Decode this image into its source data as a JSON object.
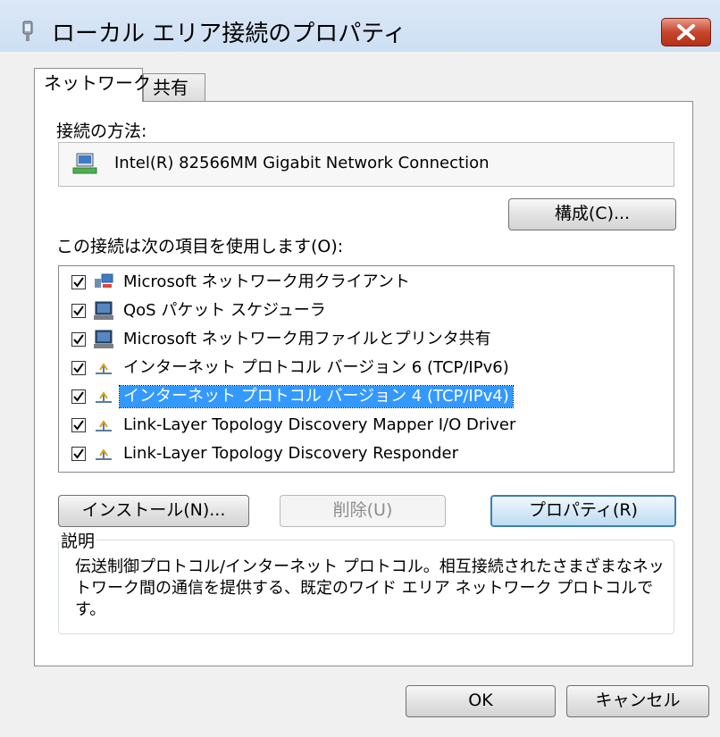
{
  "window": {
    "title": "ローカル エリア接続のプロパティ"
  },
  "tabs": [
    {
      "label": "ネットワーク"
    },
    {
      "label": "共有"
    }
  ],
  "connect_using": {
    "label": "接続の方法:",
    "adapter": "Intel(R) 82566MM Gigabit Network Connection",
    "configure_button": "構成(C)..."
  },
  "items_label": "この接続は次の項目を使用します(O):",
  "items": [
    {
      "label": "Microsoft ネットワーク用クライアント",
      "checked": true,
      "icon": "network-client-icon"
    },
    {
      "label": "QoS パケット スケジューラ",
      "checked": true,
      "icon": "service-icon"
    },
    {
      "label": "Microsoft ネットワーク用ファイルとプリンタ共有",
      "checked": true,
      "icon": "service-icon"
    },
    {
      "label": "インターネット プロトコル バージョン 6 (TCP/IPv6)",
      "checked": true,
      "icon": "protocol-icon"
    },
    {
      "label": "インターネット プロトコル バージョン 4 (TCP/IPv4)",
      "checked": true,
      "icon": "protocol-icon",
      "selected": true
    },
    {
      "label": "Link-Layer Topology Discovery Mapper I/O Driver",
      "checked": true,
      "icon": "protocol-icon"
    },
    {
      "label": "Link-Layer Topology Discovery Responder",
      "checked": true,
      "icon": "protocol-icon"
    }
  ],
  "buttons": {
    "install": "インストール(N)...",
    "uninstall": "削除(U)",
    "properties": "プロパティ(R)",
    "ok": "OK",
    "cancel": "キャンセル"
  },
  "description": {
    "legend": "説明",
    "text": "伝送制御プロトコル/インターネット プロトコル。相互接続されたさまざまなネットワーク間の通信を提供する、既定のワイド エリア ネットワーク プロトコルです。"
  },
  "colors": {
    "selection": "#3399ff",
    "close_button": "#c7452e"
  }
}
